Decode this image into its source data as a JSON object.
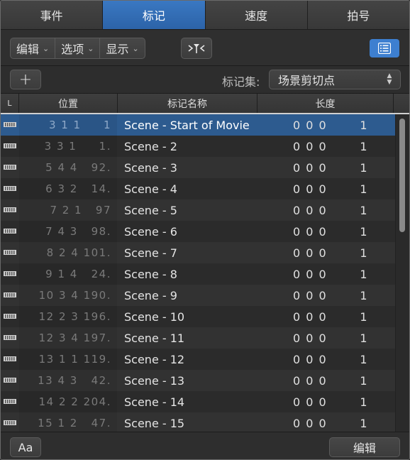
{
  "tabs": [
    {
      "label": "事件"
    },
    {
      "label": "标记"
    },
    {
      "label": "速度"
    },
    {
      "label": "拍号"
    }
  ],
  "active_tab": "标记",
  "toolbar": {
    "edit_menu": "编辑",
    "options_menu": "选项",
    "view_menu": "显示",
    "catch_icon": "playhead-catch-icon",
    "list_toggle_icon": "list-icon"
  },
  "markers_bar": {
    "add_label": "+",
    "marker_set_label": "标记集:",
    "marker_set_value": "场景剪切点"
  },
  "table": {
    "headers": {
      "lock": "L",
      "position": "位置",
      "name": "标记名称",
      "length": "长度"
    },
    "rows": [
      {
        "position": "3 1 1     1",
        "name": "Scene - Start of Movie",
        "length": "0 0 0       1",
        "selected": true
      },
      {
        "position": "3 3 1     1.",
        "name": "Scene - 2",
        "length": "0 0 0       1"
      },
      {
        "position": "5 4 4   92.",
        "name": "Scene - 3",
        "length": "0 0 0       1"
      },
      {
        "position": "6 3 2   14.",
        "name": "Scene - 4",
        "length": "0 0 0       1"
      },
      {
        "position": "7 2 1   97",
        "name": "Scene - 5",
        "length": "0 0 0       1"
      },
      {
        "position": "7 4 3   98.",
        "name": "Scene - 6",
        "length": "0 0 0       1"
      },
      {
        "position": "8 2 4 101.",
        "name": "Scene - 7",
        "length": "0 0 0       1"
      },
      {
        "position": "9 1 4   24.",
        "name": "Scene - 8",
        "length": "0 0 0       1"
      },
      {
        "position": "10 3 4 190.",
        "name": "Scene - 9",
        "length": "0 0 0       1"
      },
      {
        "position": "12 2 3 196.",
        "name": "Scene - 10",
        "length": "0 0 0       1"
      },
      {
        "position": "12 3 4 197.",
        "name": "Scene - 11",
        "length": "0 0 0       1"
      },
      {
        "position": "13 1 1 119.",
        "name": "Scene - 12",
        "length": "0 0 0       1"
      },
      {
        "position": "13 4 3   42.",
        "name": "Scene - 13",
        "length": "0 0 0       1"
      },
      {
        "position": "14 2 2 204.",
        "name": "Scene - 14",
        "length": "0 0 0       1"
      },
      {
        "position": "15 1 2   47.",
        "name": "Scene - 15",
        "length": "0 0 0       1"
      }
    ]
  },
  "footer": {
    "font_button": "Aa",
    "edit_button": "编辑"
  },
  "colors": {
    "accent": "#2c63a8",
    "selected_row": "#2d5b8f",
    "background": "#2b2b2b"
  }
}
